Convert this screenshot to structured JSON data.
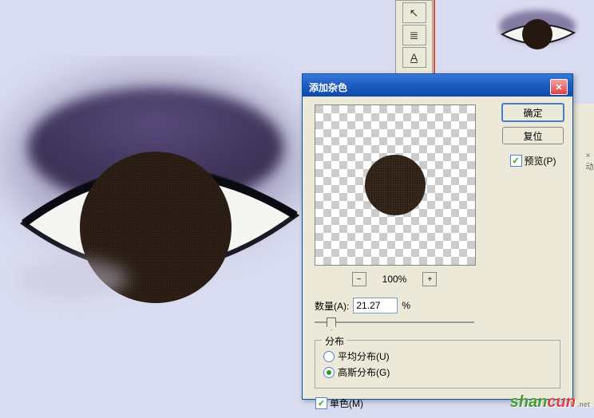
{
  "dialog": {
    "title": "添加杂色",
    "ok": "确定",
    "reset": "复位",
    "preview_label": "预览(P)",
    "zoom_pct": "100%",
    "amount_label": "数量(A):",
    "amount_value": "21.27",
    "amount_unit": "%",
    "dist_group": "分布",
    "dist_uniform": "平均分布(U)",
    "dist_gaussian": "高斯分布(G)",
    "mono": "单色(M)"
  },
  "panel_tab": "× 动",
  "watermark": {
    "g": "shan",
    "r": "cun",
    "net": ".net"
  }
}
